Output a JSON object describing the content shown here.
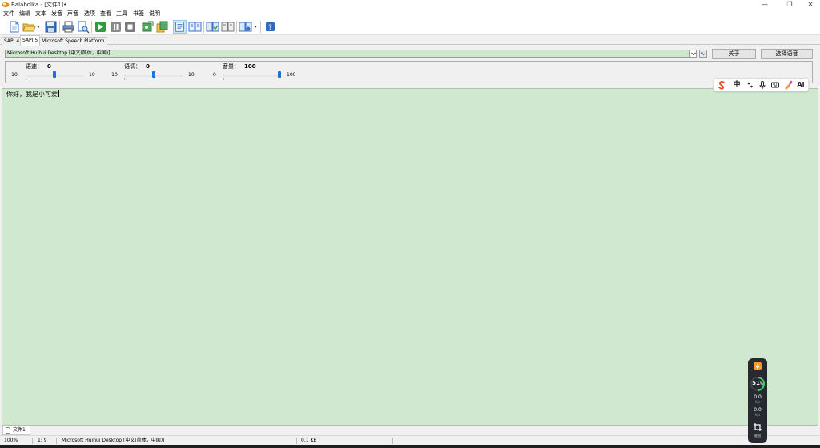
{
  "window": {
    "title": "Balabolka - [文件1]•",
    "icon": "balabolka-app-icon",
    "controls": {
      "minimize": "—",
      "maximize": "❐",
      "close": "✕"
    }
  },
  "menu": [
    "文件",
    "编辑",
    "文本",
    "发音",
    "声音",
    "选项",
    "查看",
    "工具",
    "书签",
    "说明"
  ],
  "toolbar": {
    "icons": [
      "new-document-icon",
      "open-file-icon",
      "save-icon",
      "print-icon",
      "print-preview-icon",
      "play-icon",
      "pause-icon",
      "stop-icon",
      "save-audio-icon",
      "convert-files-icon",
      "view-text-icon",
      "read-clipboard-icon",
      "spell-check-icon",
      "dictionary-icon",
      "speech-settings-icon",
      "help-icon"
    ],
    "selected": "view-text-icon",
    "help_label": "?"
  },
  "sapi_tabs": [
    "SAPI 4",
    "SAPI 5",
    "Microsoft Speech Platform"
  ],
  "sapi_active": "SAPI 5",
  "voice": {
    "selected": "Microsoft Huihui Desktop [中文(简体，中国)]",
    "about_button": "关于",
    "select_voice_button": "选择语音"
  },
  "sliders": {
    "rate": {
      "label": "语速：",
      "value": "0",
      "min": "-10",
      "max": "10",
      "fraction": 0.5
    },
    "pitch": {
      "label": "语调：",
      "value": "0",
      "min": "-10",
      "max": "10",
      "fraction": 0.5
    },
    "volume": {
      "label": "音量：",
      "value": "100",
      "min": "0",
      "max": "100",
      "fraction": 1.0
    }
  },
  "ime_toolbar": {
    "icons": [
      "sogou-logo-icon",
      "chinese-mode-icon",
      "punctuation-icon",
      "microphone-icon",
      "keyboard-icon",
      "skin-icon",
      "ai-icon"
    ],
    "chinese_mode_label": "中",
    "ai_label": "AI"
  },
  "editor": {
    "text": "你好，我是小可爱",
    "background": "#cfe8cf"
  },
  "document_tabs": [
    "文件1"
  ],
  "status": {
    "zoom": "100%",
    "position": "1:  9",
    "voice": "Microsoft Huihui Desktop [中文(简体，中国)]",
    "size": "0.1 KB"
  },
  "perf_widget": {
    "cpu": "51",
    "cpu_unit": "%",
    "upload": "0.0",
    "upload_unit": "K/s",
    "download": "0.0",
    "download_unit": "K/s",
    "screenshot_label": "截图"
  },
  "colors": {
    "accent": "#1f6fd8",
    "editor_bg": "#cfe8cf",
    "selected_tool": "#cce4f7"
  }
}
